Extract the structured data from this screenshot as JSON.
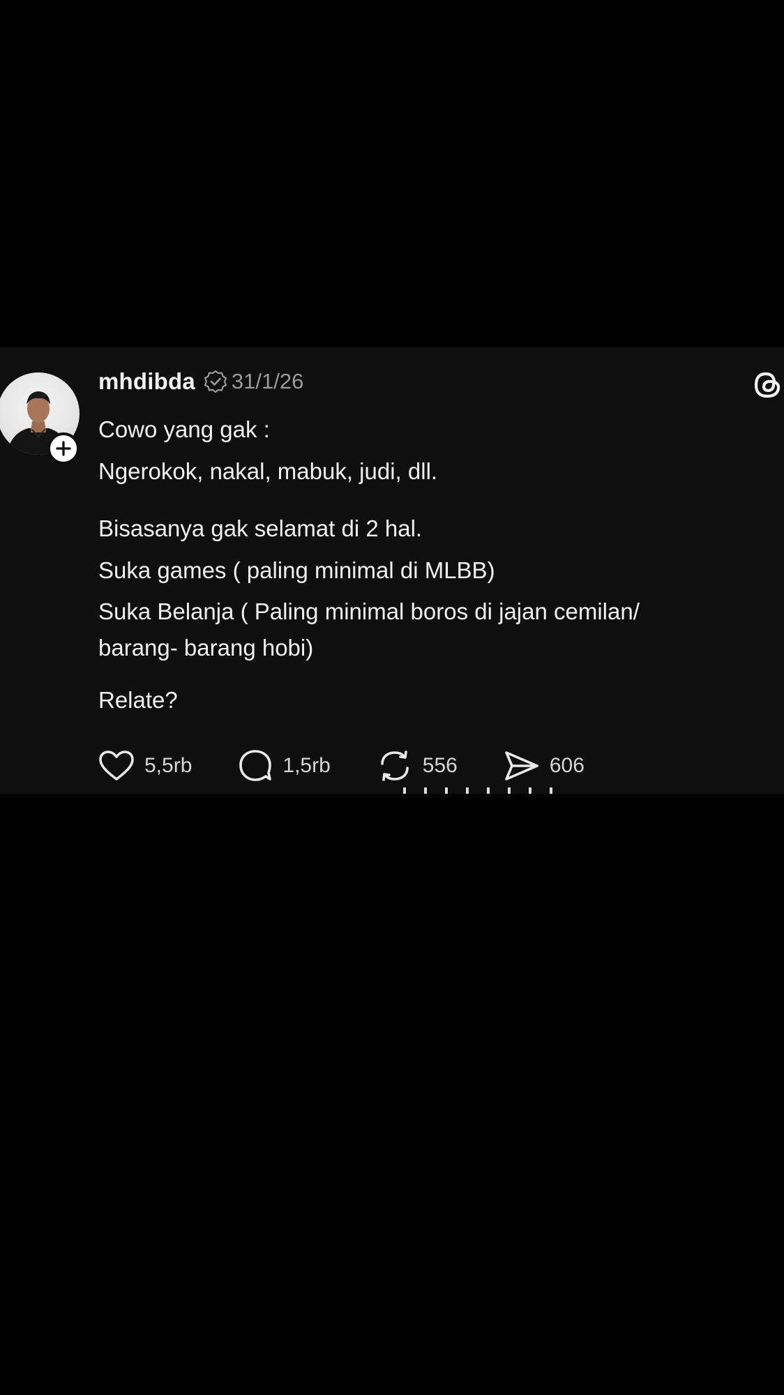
{
  "post": {
    "username": "mhdibda",
    "timestamp": "31/1/26",
    "lines": {
      "l1": "Cowo yang gak :",
      "l2": "Ngerokok, nakal, mabuk, judi, dll.",
      "l3": "Bisasanya gak selamat di 2 hal.",
      "l4": "Suka games ( paling minimal di MLBB)",
      "l5": "Suka Belanja ( Paling minimal boros di jajan cemilan/",
      "l6": "barang- barang hobi)",
      "l7": "Relate?"
    }
  },
  "actions": {
    "likes": "5,5rb",
    "comments": "1,5rb",
    "reposts": "556",
    "shares": "606"
  },
  "icons": {
    "verified": "verified-badge-icon",
    "threads": "threads-logo-icon",
    "follow": "plus-icon",
    "like": "heart-icon",
    "comment": "comment-bubble-icon",
    "repost": "repost-icon",
    "share": "send-icon"
  },
  "colors": {
    "background": "#000000",
    "card": "#0f0f0f",
    "text": "#f0f0f0",
    "muted": "#9a9a9a"
  }
}
